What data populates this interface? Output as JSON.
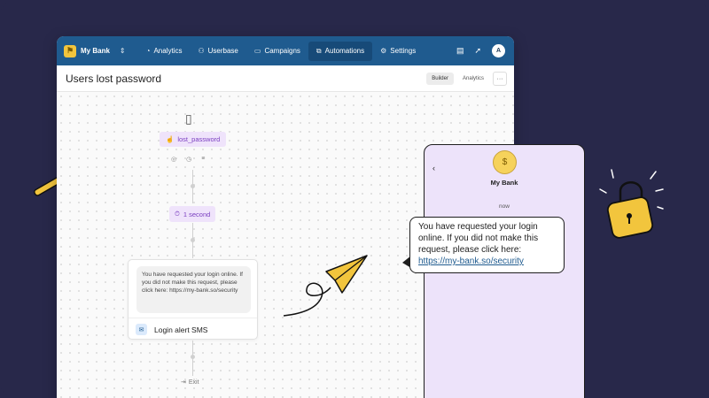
{
  "navbar": {
    "brand": "My Bank",
    "items": [
      {
        "label": "Analytics",
        "icon": "chart-icon",
        "active": false
      },
      {
        "label": "Userbase",
        "icon": "users-icon",
        "active": false
      },
      {
        "label": "Campaigns",
        "icon": "megaphone-icon",
        "active": false
      },
      {
        "label": "Automations",
        "icon": "flow-icon",
        "active": true
      },
      {
        "label": "Settings",
        "icon": "gear-icon",
        "active": false
      }
    ],
    "avatar_initial": "A"
  },
  "titlebar": {
    "title": "Users lost password",
    "builder_label": "Builder",
    "analytics_label": "Analytics",
    "more_label": "···"
  },
  "flow": {
    "trigger": "lost_password",
    "delay": "1 second",
    "sms_text": "You have requested your login online. If you did not make this request, please click here: https://my-bank.so/security",
    "sms_label": "Login alert SMS",
    "exit_label": "Exit"
  },
  "phone": {
    "sender": "My Bank",
    "time": "now",
    "message_text": "You have requested your login online. If you did not make this request, please click here: ",
    "message_link": "https://my-bank.so/security"
  },
  "colors": {
    "background": "#28284a",
    "navbar": "#1f5b8f",
    "chip": "#efe3fb",
    "phone": "#ede3fa",
    "accent_yellow": "#f2c53d"
  }
}
